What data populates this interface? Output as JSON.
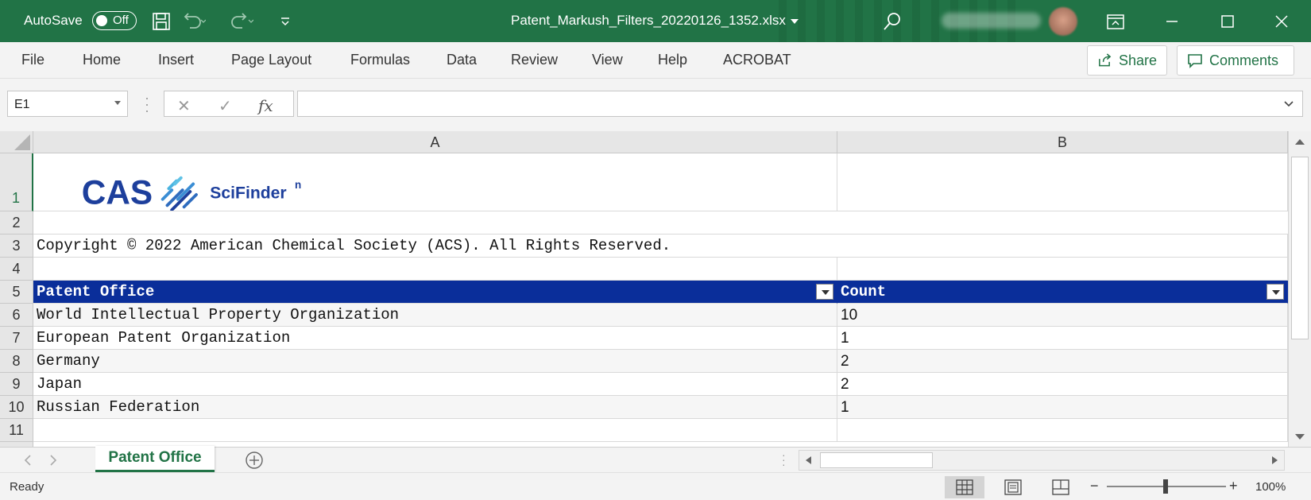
{
  "titlebar": {
    "autosave_label": "AutoSave",
    "autosave_state": "Off",
    "filename": "Patent_Markush_Filters_20220126_1352.xlsx",
    "icons": [
      "save-icon",
      "undo-icon",
      "redo-icon",
      "customize-icon",
      "search-icon",
      "ribbon-display-icon",
      "minimize-icon",
      "maximize-icon",
      "close-icon"
    ]
  },
  "ribbon": {
    "tabs": [
      "File",
      "Home",
      "Insert",
      "Page Layout",
      "Formulas",
      "Data",
      "Review",
      "View",
      "Help",
      "ACROBAT"
    ],
    "share_label": "Share",
    "comments_label": "Comments"
  },
  "formula_bar": {
    "name_box": "E1",
    "fx_label": "fx",
    "cancel_label": "✕",
    "enter_label": "✓",
    "formula": ""
  },
  "grid": {
    "columns": [
      "A",
      "B"
    ],
    "rows": [
      "1",
      "2",
      "3",
      "4",
      "5",
      "6",
      "7",
      "8",
      "9",
      "10",
      "11"
    ],
    "logo": {
      "cas": "CAS",
      "scifinder": "SciFinder",
      "sup": "n"
    },
    "copyright": "Copyright © 2022 American Chemical Society (ACS).  All Rights Reserved.",
    "table_header": {
      "a": "Patent Office",
      "b": "Count"
    },
    "table_rows": [
      {
        "office": "World Intellectual Property Organization",
        "count": "10"
      },
      {
        "office": "European Patent Organization",
        "count": "1"
      },
      {
        "office": "Germany",
        "count": "2"
      },
      {
        "office": "Japan",
        "count": "2"
      },
      {
        "office": "Russian Federation",
        "count": "1"
      }
    ]
  },
  "sheet_tabs": {
    "active": "Patent Office"
  },
  "statusbar": {
    "status": "Ready",
    "zoom": "100%",
    "zoom_minus": "−",
    "zoom_plus": "+"
  },
  "colors": {
    "excel_green": "#217346",
    "table_header_bg": "#0a2e9a",
    "cas_blue": "#1d3f9c"
  }
}
